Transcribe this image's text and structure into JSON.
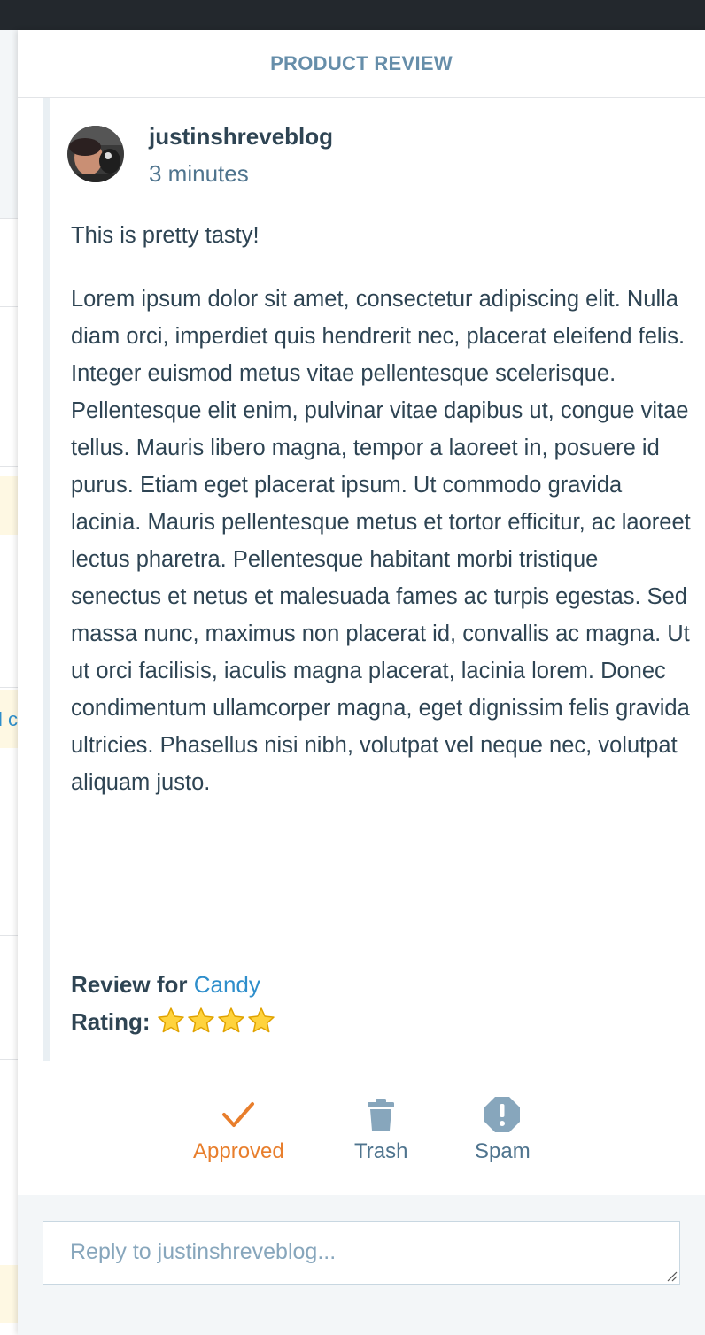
{
  "panel": {
    "title": "PRODUCT REVIEW"
  },
  "review": {
    "author": "justinshreveblog",
    "time": "3 minutes",
    "paragraphs": [
      "This is pretty tasty!",
      "Lorem ipsum dolor sit amet, consectetur adipiscing elit. Nulla diam orci, imperdiet quis hendrerit nec, placerat eleifend felis. Integer euismod metus vitae pellentesque scelerisque. Pellentesque elit enim, pulvinar vitae dapibus ut, congue vitae tellus. Mauris libero magna, tempor a laoreet in, posuere id purus. Etiam eget placerat ipsum. Ut commodo gravida lacinia. Mauris pellentesque metus et tortor efficitur, ac laoreet lectus pharetra. Pellentesque habitant morbi tristique senectus et netus et malesuada fames ac turpis egestas. Sed massa nunc, maximus non placerat id, convallis ac magna. Ut ut orci facilisis, iaculis magna placerat, lacinia lorem. Donec condimentum ullamcorper magna, eget dignissim felis gravida ultricies. Phasellus nisi nibh, volutpat vel neque nec, volutpat aliquam justo."
    ],
    "review_for_label": "Review for",
    "product_name": "Candy",
    "rating_label": "Rating:",
    "rating": 4
  },
  "actions": {
    "approved": {
      "label": "Approved",
      "icon": "checkmark-icon",
      "color": "#e87e2c"
    },
    "trash": {
      "label": "Trash",
      "icon": "trash-icon"
    },
    "spam": {
      "label": "Spam",
      "icon": "spam-icon"
    }
  },
  "reply": {
    "placeholder": "Reply to justinshreveblog..."
  }
}
